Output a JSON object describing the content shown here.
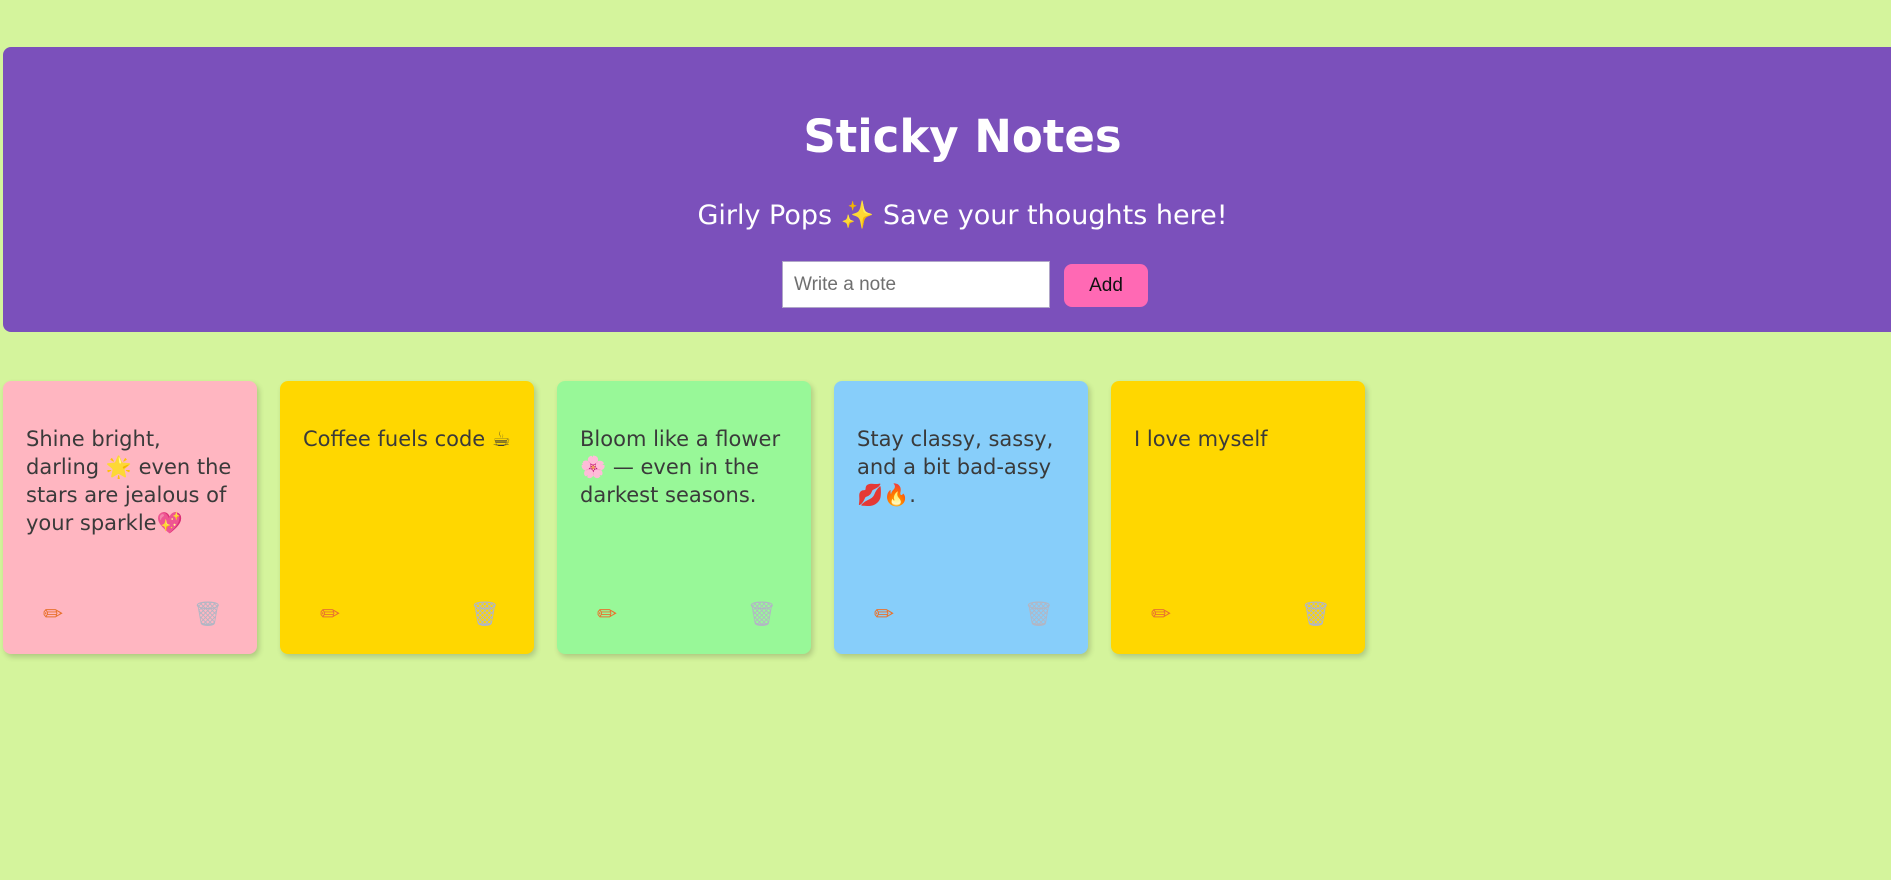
{
  "header": {
    "title": "Sticky Notes",
    "subtitle": "Girly Pops ✨ Save your thoughts here!",
    "input_placeholder": "Write a note",
    "add_label": "Add"
  },
  "colors": {
    "page_background": "#d4f49c",
    "header_background": "#7b50bb",
    "add_button": "#ff69b4"
  },
  "notes": [
    {
      "text": "Shine bright, darling 🌟 even the stars are jealous of your sparkle💖",
      "color": "#ffb6c1",
      "edit_icon": "pencil-icon",
      "delete_icon": "trash-icon"
    },
    {
      "text": "Coffee fuels code ☕",
      "color": "#ffd700",
      "edit_icon": "pencil-icon",
      "delete_icon": "trash-icon"
    },
    {
      "text": "Bloom like a flower 🌸 — even in the darkest seasons.",
      "color": "#98f898",
      "edit_icon": "pencil-icon",
      "delete_icon": "trash-icon"
    },
    {
      "text": "Stay classy, sassy, and a bit bad-assy 💋🔥.",
      "color": "#87cefa",
      "edit_icon": "pencil-icon",
      "delete_icon": "trash-icon"
    },
    {
      "text": "I love myself",
      "color": "#ffd700",
      "edit_icon": "pencil-icon",
      "delete_icon": "trash-icon"
    }
  ]
}
